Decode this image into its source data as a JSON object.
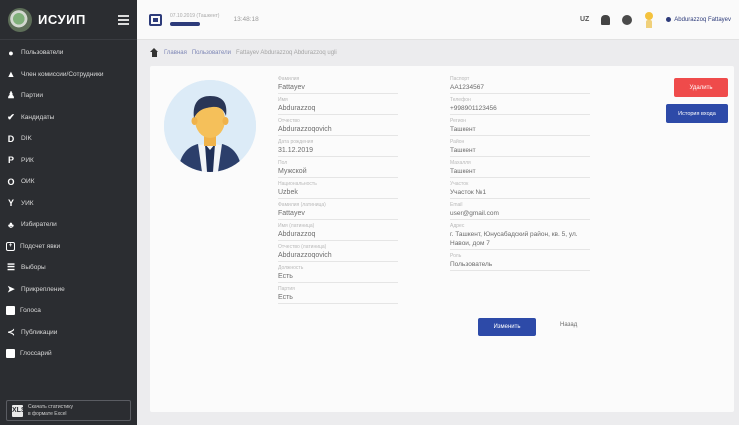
{
  "app": {
    "name": "ИСУИП",
    "export_label_1": "Скачать статистику",
    "export_label_2": "в формате Excel",
    "export_icon": "XLS"
  },
  "sidebar": {
    "items": [
      {
        "icon": "user-icon",
        "label": "Пользователи"
      },
      {
        "icon": "person-icon",
        "label": "Член комиссии/Сотрудники"
      },
      {
        "icon": "party-icon",
        "label": "Партии"
      },
      {
        "icon": "check-icon",
        "label": "Кандидаты"
      },
      {
        "icon": "dik-icon",
        "label": "DIK"
      },
      {
        "icon": "rik-icon",
        "label": "РИК"
      },
      {
        "icon": "oik-icon",
        "label": "ОИК"
      },
      {
        "icon": "uik-icon",
        "label": "УИК"
      },
      {
        "icon": "voters-icon",
        "label": "Избиратели"
      },
      {
        "icon": "plus-box-icon",
        "label": "Подсчет явки"
      },
      {
        "icon": "list-icon",
        "label": "Выборы"
      },
      {
        "icon": "pin-icon",
        "label": "Прикрепление"
      },
      {
        "icon": "vote-icon",
        "label": "Голоса"
      },
      {
        "icon": "share-icon",
        "label": "Публикации"
      },
      {
        "icon": "glossary-icon",
        "label": "Глоссарий"
      }
    ]
  },
  "topbar": {
    "date_label": "07.10.2019 (Ташкент)",
    "time": "13:48:18",
    "language": "UZ",
    "user_name": "Abdurazzoq Fattayev"
  },
  "breadcrumb": [
    "Главная",
    "Пользователи",
    "Fattayev Abdurazzoq Abdurazzoq ugli"
  ],
  "profile": {
    "left_fields": [
      {
        "label": "Фамилия",
        "value": "Fattayev"
      },
      {
        "label": "Имя",
        "value": "Abdurazzoq"
      },
      {
        "label": "Отчество",
        "value": "Abdurazzoqovich"
      },
      {
        "label": "Дата рождения",
        "value": "31.12.2019"
      },
      {
        "label": "Пол",
        "value": "Мужской"
      },
      {
        "label": "Национальность",
        "value": "Uzbek"
      },
      {
        "label": "Фамилия (латиница)",
        "value": "Fattayev"
      },
      {
        "label": "Имя (латиница)",
        "value": "Abdurazzoq"
      },
      {
        "label": "Отчество (латиница)",
        "value": "Abdurazzoqovich"
      },
      {
        "label": "Должность",
        "value": "Есть"
      },
      {
        "label": "Партия",
        "value": "Есть"
      }
    ],
    "right_fields": [
      {
        "label": "Паспорт",
        "value": "AA1234567"
      },
      {
        "label": "Телефон",
        "value": "+998901123456"
      },
      {
        "label": "Регион",
        "value": "Ташкент"
      },
      {
        "label": "Район",
        "value": "Ташкент"
      },
      {
        "label": "Махалля",
        "value": "Ташкент"
      },
      {
        "label": "Участок",
        "value": "Участок №1"
      },
      {
        "label": "Email",
        "value": "user@gmail.com"
      },
      {
        "label": "Адрес",
        "value": "г. Ташкент, Юнусабадский район, кв. 5, ул. Навои, дом 7"
      },
      {
        "label": "Роль",
        "value": "Пользователь"
      }
    ],
    "delete_button": "Удалить",
    "history_button": "История входа",
    "edit_button": "Изменить",
    "back_link": "Назад"
  },
  "colors": {
    "sidebar_bg": "#2b2d31",
    "primary": "#2d4aa8",
    "danger": "#ef4b4b"
  }
}
